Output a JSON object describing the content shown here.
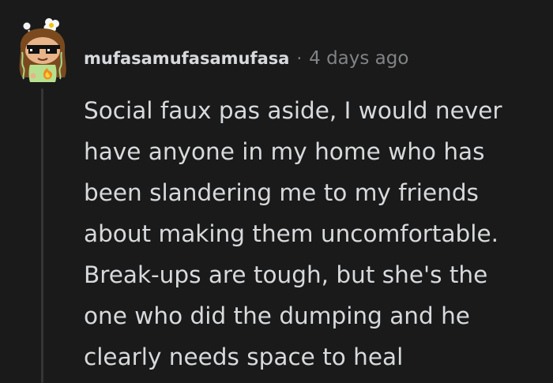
{
  "comment": {
    "author": "mufasamufasamufasa",
    "separator": "·",
    "timestamp": "4 days ago",
    "avatar_icon": "snoo-avatar-sunglasses-icon",
    "body": "Social faux pas aside, I would never\nhave anyone in my home who has\nbeen slandering me to my friends\nabout making them uncomfortable.\nBreak-ups are tough, but she's the\none who did the dumping and he\nclearly needs space to heal"
  },
  "colors": {
    "background": "#1a1a1b",
    "text": "#d7dadc",
    "meta_text": "#818384",
    "thread_line": "#343536"
  }
}
